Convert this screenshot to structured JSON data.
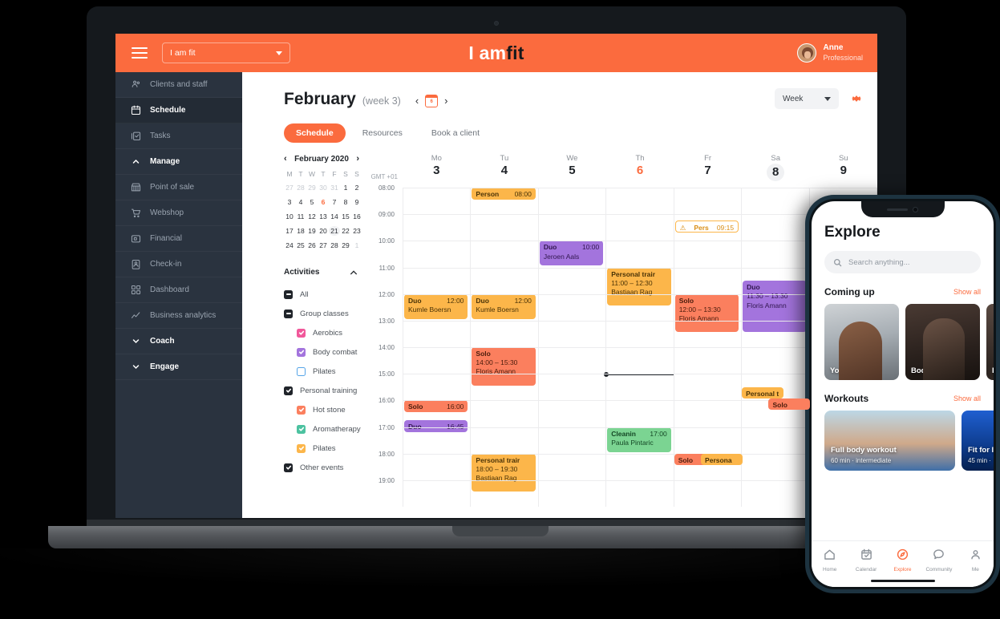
{
  "topbar": {
    "org_name": "I am fit",
    "brand_white": "I am",
    "brand_black": "fit",
    "user_name": "Anne",
    "user_role": "Professional",
    "accent": "#fb6b3e"
  },
  "sidebar": {
    "items": [
      {
        "label": "Clients and staff",
        "icon": "clients-icon",
        "type": "item",
        "active": false
      },
      {
        "label": "Schedule",
        "icon": "calendar-icon",
        "type": "item",
        "active": true
      },
      {
        "label": "Tasks",
        "icon": "tasks-icon",
        "type": "item",
        "active": false
      },
      {
        "label": "Manage",
        "icon": "chevron-up-icon",
        "type": "group",
        "expanded": true
      },
      {
        "label": "Point of sale",
        "icon": "store-icon",
        "type": "item",
        "active": false
      },
      {
        "label": "Webshop",
        "icon": "cart-icon",
        "type": "item",
        "active": false
      },
      {
        "label": "Financial",
        "icon": "wallet-icon",
        "type": "item",
        "active": false
      },
      {
        "label": "Check-in",
        "icon": "badge-icon",
        "type": "item",
        "active": false
      },
      {
        "label": "Dashboard",
        "icon": "dashboard-icon",
        "type": "item",
        "active": false
      },
      {
        "label": "Business analytics",
        "icon": "analytics-icon",
        "type": "item",
        "active": false
      },
      {
        "label": "Coach",
        "icon": "chevron-down-icon",
        "type": "group",
        "expanded": false
      },
      {
        "label": "Engage",
        "icon": "chevron-down-icon",
        "type": "group",
        "expanded": false
      }
    ]
  },
  "main": {
    "title": "February",
    "subtitle": "(week 3)",
    "prev_label": "‹",
    "next_label": "›",
    "today_badge": "6",
    "tabs": [
      {
        "label": "Schedule",
        "active": true
      },
      {
        "label": "Resources",
        "active": false
      },
      {
        "label": "Book a client",
        "active": false
      }
    ],
    "view_select": "Week",
    "settings_icon": "gear-icon"
  },
  "mini_calendar": {
    "month_label": "February 2020",
    "prev": "‹",
    "next": "›",
    "dow": [
      "M",
      "T",
      "W",
      "T",
      "F",
      "S",
      "S"
    ],
    "weeks": [
      [
        {
          "d": "27",
          "s": "mut"
        },
        {
          "d": "28",
          "s": "mut"
        },
        {
          "d": "29",
          "s": "mut"
        },
        {
          "d": "30",
          "s": "mut"
        },
        {
          "d": "31",
          "s": "mut"
        },
        {
          "d": "1",
          "s": ""
        },
        {
          "d": "2",
          "s": ""
        }
      ],
      [
        {
          "d": "3",
          "s": ""
        },
        {
          "d": "4",
          "s": ""
        },
        {
          "d": "5",
          "s": ""
        },
        {
          "d": "6",
          "s": "hot"
        },
        {
          "d": "7",
          "s": ""
        },
        {
          "d": "8",
          "s": ""
        },
        {
          "d": "9",
          "s": ""
        }
      ],
      [
        {
          "d": "10",
          "s": ""
        },
        {
          "d": "11",
          "s": ""
        },
        {
          "d": "12",
          "s": ""
        },
        {
          "d": "13",
          "s": ""
        },
        {
          "d": "14",
          "s": ""
        },
        {
          "d": "15",
          "s": ""
        },
        {
          "d": "16",
          "s": ""
        }
      ],
      [
        {
          "d": "17",
          "s": ""
        },
        {
          "d": "18",
          "s": ""
        },
        {
          "d": "19",
          "s": ""
        },
        {
          "d": "20",
          "s": ""
        },
        {
          "d": "21",
          "s": "sel"
        },
        {
          "d": "22",
          "s": ""
        },
        {
          "d": "23",
          "s": ""
        }
      ],
      [
        {
          "d": "24",
          "s": ""
        },
        {
          "d": "25",
          "s": ""
        },
        {
          "d": "26",
          "s": ""
        },
        {
          "d": "27",
          "s": ""
        },
        {
          "d": "28",
          "s": ""
        },
        {
          "d": "29",
          "s": ""
        },
        {
          "d": "1",
          "s": "mut"
        }
      ]
    ]
  },
  "activities": {
    "title": "Activities",
    "collapse_icon": "chevron-up-icon",
    "items": [
      {
        "label": "All",
        "state": "indeterminate",
        "color": "#20242a",
        "indent": 0
      },
      {
        "label": "Group classes",
        "state": "indeterminate",
        "color": "#20242a",
        "indent": 0
      },
      {
        "label": "Aerobics",
        "state": "checked",
        "color": "#f1589a",
        "indent": 1
      },
      {
        "label": "Body combat",
        "state": "checked",
        "color": "#a374dd",
        "indent": 1
      },
      {
        "label": "Pilates",
        "state": "unchecked",
        "color": "#56a5e8",
        "indent": 1
      },
      {
        "label": "Personal training",
        "state": "checked",
        "color": "#20242a",
        "indent": 0
      },
      {
        "label": "Hot stone",
        "state": "checked",
        "color": "#fb7f5e",
        "indent": 1
      },
      {
        "label": "Aromatherapy",
        "state": "checked",
        "color": "#4cc2a0",
        "indent": 1
      },
      {
        "label": "Pilates",
        "state": "checked",
        "color": "#fcb64a",
        "indent": 1
      },
      {
        "label": "Other events",
        "state": "checked",
        "color": "#20242a",
        "indent": 0
      }
    ]
  },
  "schedule": {
    "timezone": "GMT +01",
    "days": [
      {
        "dow": "Mo",
        "num": "3",
        "style": ""
      },
      {
        "dow": "Tu",
        "num": "4",
        "style": ""
      },
      {
        "dow": "We",
        "num": "5",
        "style": ""
      },
      {
        "dow": "Th",
        "num": "6",
        "style": "hot"
      },
      {
        "dow": "Fr",
        "num": "7",
        "style": ""
      },
      {
        "dow": "Sa",
        "num": "8",
        "style": "sel"
      },
      {
        "dow": "Su",
        "num": "9",
        "style": ""
      }
    ],
    "times": [
      "08:00",
      "09:00",
      "10:00",
      "11:00",
      "12:00",
      "13:00",
      "14:00",
      "15:00",
      "16:00",
      "17:00",
      "18:00",
      "19:00"
    ],
    "events": [
      {
        "col": 1,
        "start": "08:00",
        "dur": 30,
        "color": "orange",
        "title": "Person",
        "time": "08:00",
        "person": "",
        "inline": true,
        "lane": 0,
        "lanes": 1
      },
      {
        "col": 1,
        "start": "12:00",
        "dur": 60,
        "color": "orange",
        "title": "Duo",
        "time": "12:00",
        "person": "Kumle Boersn",
        "inline": true,
        "lane": 0,
        "lanes": 1
      },
      {
        "col": 1,
        "start": "14:00",
        "dur": 90,
        "color": "coral",
        "title": "Solo",
        "time": "14:00 – 15:30",
        "person": "Floris Amann",
        "inline": false,
        "lane": 0,
        "lanes": 1
      },
      {
        "col": 1,
        "start": "18:00",
        "dur": 90,
        "color": "orange",
        "title": "Personal trair",
        "time": "18:00 – 19:30",
        "person": "Bastiaan Rag",
        "inline": false,
        "lane": 0,
        "lanes": 1
      },
      {
        "col": 0,
        "start": "12:00",
        "dur": 60,
        "color": "orange",
        "title": "Duo",
        "time": "12:00",
        "person": "Kumle Boersn",
        "inline": true,
        "lane": 0,
        "lanes": 1
      },
      {
        "col": 0,
        "start": "16:00",
        "dur": 30,
        "color": "coral",
        "title": "Solo",
        "time": "16:00",
        "person": "",
        "inline": true,
        "lane": 0,
        "lanes": 1
      },
      {
        "col": 0,
        "start": "16:45",
        "dur": 30,
        "color": "purple",
        "title": "Duo",
        "time": "16:45",
        "person": "",
        "inline": true,
        "lane": 0,
        "lanes": 1
      },
      {
        "col": 2,
        "start": "10:00",
        "dur": 60,
        "color": "purple",
        "title": "Duo",
        "time": "10:00",
        "person": "Jeroen Aals",
        "inline": true,
        "lane": 0,
        "lanes": 1
      },
      {
        "col": 3,
        "start": "11:00",
        "dur": 90,
        "color": "orange",
        "title": "Personal trair",
        "time": "11:00 – 12:30",
        "person": "Bastiaan Rag",
        "inline": false,
        "lane": 0,
        "lanes": 1
      },
      {
        "col": 3,
        "start": "17:00",
        "dur": 60,
        "color": "green",
        "title": "Cleanin",
        "time": "17:00",
        "person": "Paula Pintaric",
        "inline": true,
        "lane": 0,
        "lanes": 1
      },
      {
        "col": 4,
        "start": "09:15",
        "dur": 30,
        "color": "ghost",
        "title": "Pers",
        "time": "09:15",
        "person": "",
        "inline": true,
        "lane": 0,
        "lanes": 1,
        "warn": true
      },
      {
        "col": 4,
        "start": "12:00",
        "dur": 90,
        "color": "coral",
        "title": "Solo",
        "time": "12:00 – 13:30",
        "person": "Floris Amann",
        "inline": false,
        "lane": 0,
        "lanes": 1
      },
      {
        "col": 4,
        "start": "18:00",
        "dur": 30,
        "color": "coral",
        "title": "Solo",
        "time": "",
        "person": "",
        "inline": true,
        "lane": 0,
        "lanes": 2
      },
      {
        "col": 4,
        "start": "18:00",
        "dur": 30,
        "color": "orange",
        "title": "Persona",
        "time": "",
        "person": "",
        "inline": true,
        "lane": 1,
        "lanes": 2
      },
      {
        "col": 5,
        "start": "11:30",
        "dur": 120,
        "color": "purple",
        "title": "Duo",
        "time": "11:30 – 13:30",
        "person": "Floris Amann",
        "inline": false,
        "lane": 0,
        "lanes": 1
      },
      {
        "col": 5,
        "start": "15:30",
        "dur": 30,
        "color": "orange",
        "title": "Personal t",
        "time": "",
        "person": "",
        "inline": true,
        "lane": 0,
        "lanes": 2
      },
      {
        "col": 5,
        "start": "15:55",
        "dur": 30,
        "color": "coral",
        "title": "Solo",
        "time": "",
        "person": "",
        "inline": true,
        "lane": 1,
        "lanes": 2
      }
    ],
    "now_time": "15:00",
    "now_col": 3
  },
  "phone": {
    "title": "Explore",
    "search_placeholder": "Search anything...",
    "search_icon": "search-icon",
    "sections": [
      {
        "title": "Coming up",
        "link": "Show all",
        "cards": [
          {
            "label": "Yoga",
            "style": "card-yoga"
          },
          {
            "label": "Body combat",
            "style": "card-combat"
          },
          {
            "label": "B",
            "style": "card-third"
          }
        ]
      }
    ],
    "workouts": {
      "title": "Workouts",
      "link": "Show all",
      "cards": [
        {
          "title": "Full body workout",
          "meta": "60 min  ·  intermediate",
          "style": "a"
        },
        {
          "title": "Fit for li",
          "meta": "45 min  ·",
          "style": "b"
        }
      ]
    },
    "nav": [
      {
        "label": "Home",
        "icon": "home-icon",
        "active": false
      },
      {
        "label": "Calendar",
        "icon": "calendar-icon",
        "active": false
      },
      {
        "label": "Explore",
        "icon": "compass-icon",
        "active": true
      },
      {
        "label": "Community",
        "icon": "chat-icon",
        "active": false
      },
      {
        "label": "Me",
        "icon": "person-icon",
        "active": false
      }
    ]
  }
}
